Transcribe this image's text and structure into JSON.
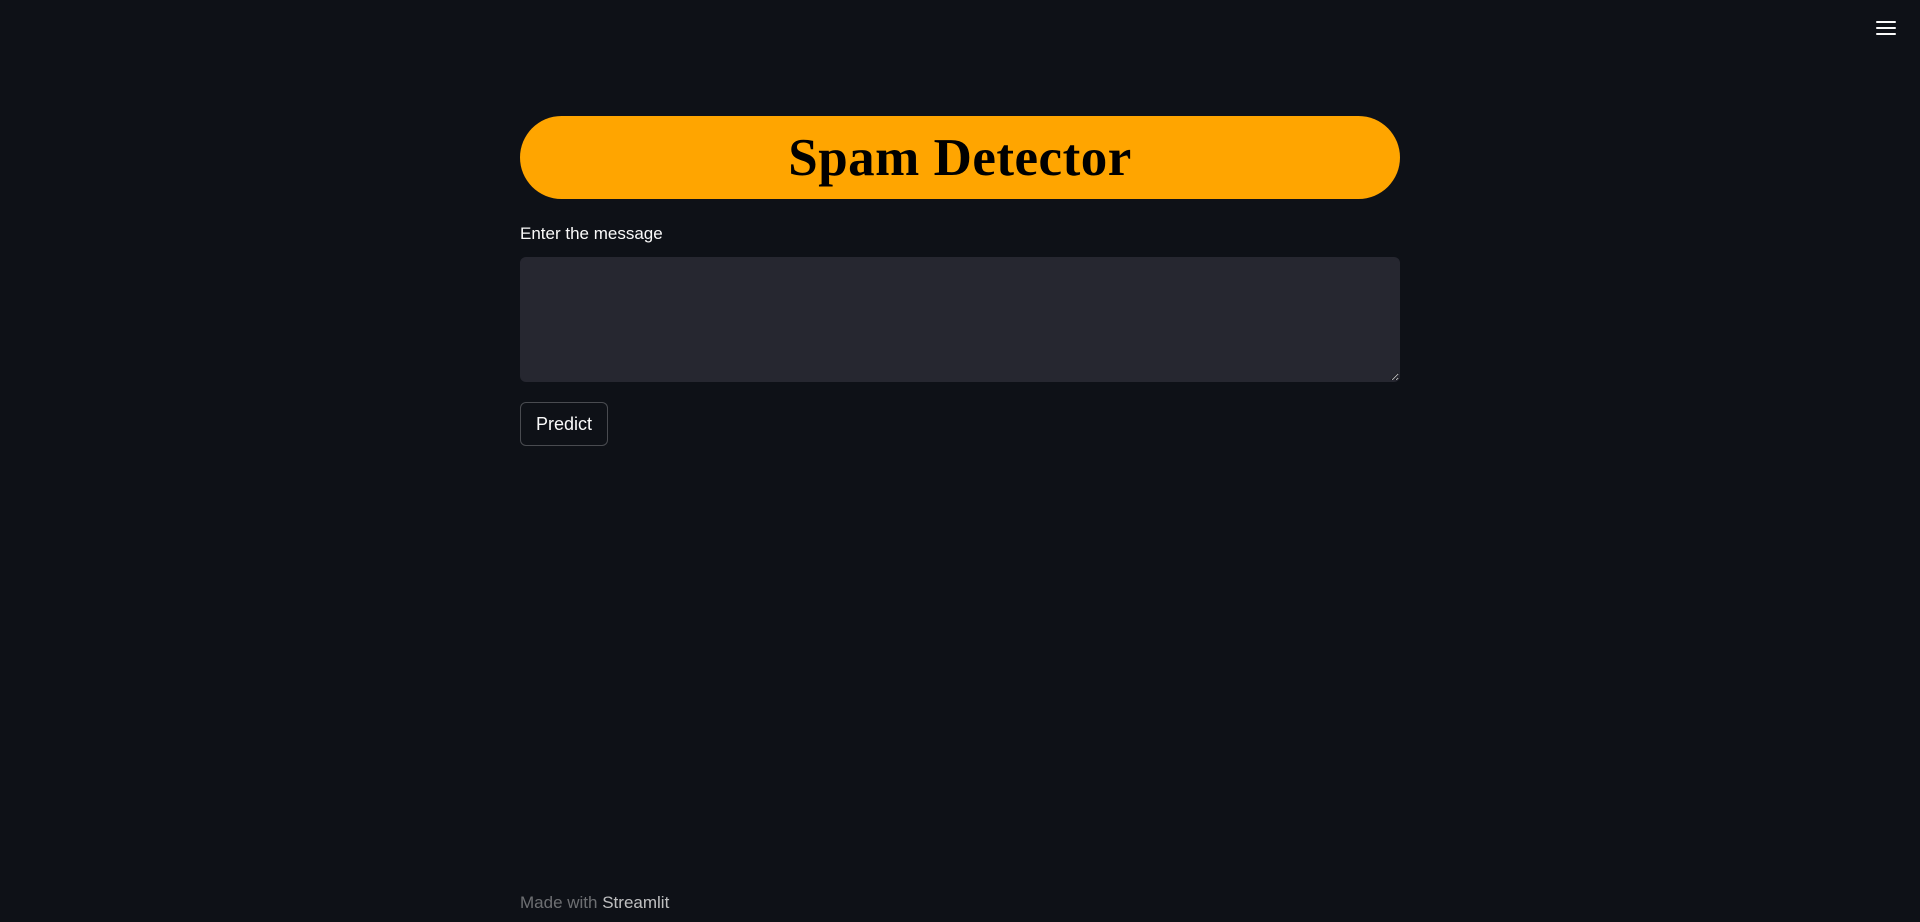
{
  "header": {
    "menu_icon": "hamburger-menu-icon"
  },
  "main": {
    "title": "Spam Detector",
    "title_bg_color": "#ffa500",
    "message_label": "Enter the message",
    "message_value": "",
    "message_placeholder": "",
    "predict_label": "Predict"
  },
  "footer": {
    "prefix": "Made with",
    "brand": "Streamlit"
  },
  "colors": {
    "background": "#0e1117",
    "input_bg": "#262730",
    "accent": "#ffa500"
  }
}
